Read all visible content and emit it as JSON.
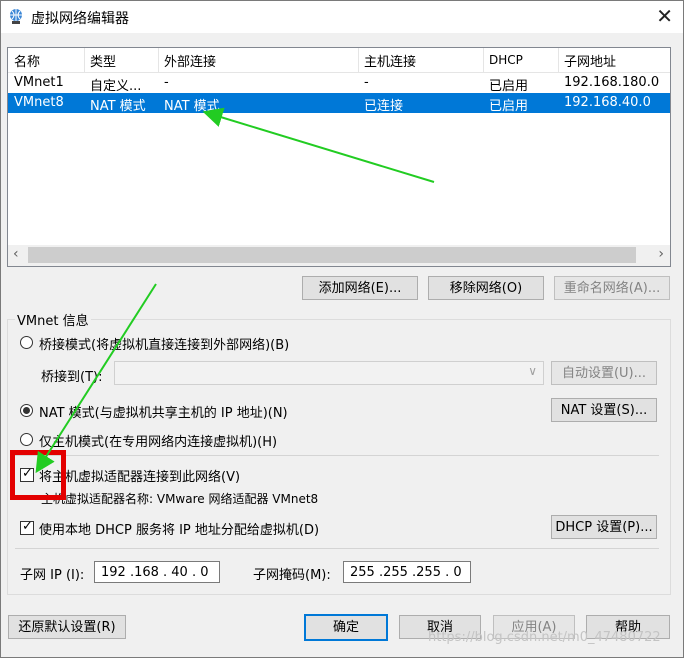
{
  "window": {
    "title": "虚拟网络编辑器",
    "close_glyph": "✕"
  },
  "table": {
    "columns": [
      "名称",
      "类型",
      "外部连接",
      "主机连接",
      "DHCP",
      "子网地址"
    ],
    "rows": [
      {
        "name": "VMnet1",
        "type": "自定义...",
        "external": "-",
        "host": "-",
        "dhcp": "已启用",
        "subnet": "192.168.180.0"
      },
      {
        "name": "VMnet8",
        "type": "NAT 模式",
        "external": "NAT 模式",
        "host": "已连接",
        "dhcp": "已启用",
        "subnet": "192.168.40.0",
        "selected": true
      }
    ]
  },
  "buttons": {
    "add_network": "添加网络(E)...",
    "remove_network": "移除网络(O)",
    "rename_network": "重命名网络(A)...",
    "auto_settings": "自动设置(U)...",
    "nat_settings": "NAT 设置(S)...",
    "dhcp_settings": "DHCP 设置(P)...",
    "restore_defaults": "还原默认设置(R)",
    "ok": "确定",
    "cancel": "取消",
    "apply": "应用(A)",
    "help": "帮助"
  },
  "vmnet_info": {
    "group_title": "VMnet 信息",
    "bridged_label": "桥接模式(将虚拟机直接连接到外部网络)(B)",
    "bridged_to_label": "桥接到(T):",
    "nat_label": "NAT 模式(与虚拟机共享主机的 IP 地址)(N)",
    "host_only_label": "仅主机模式(在专用网络内连接虚拟机)(H)",
    "connect_adapter_label": "将主机虚拟适配器连接到此网络(V)",
    "adapter_name_label": "主机虚拟适配器名称: VMware 网络适配器 VMnet8",
    "use_dhcp_label": "使用本地 DHCP 服务将 IP 地址分配给虚拟机(D)",
    "subnet_ip_label": "子网 IP (I):",
    "subnet_ip_value": "192 .168 . 40 .  0",
    "subnet_mask_label": "子网掩码(M):",
    "subnet_mask_value": "255 .255 .255 .  0",
    "selected_mode": "nat",
    "connect_adapter_checked": true,
    "use_dhcp_checked": true
  },
  "watermark": "https://blog.csdn.net/m0_47480722",
  "colors": {
    "selection": "#0078d7",
    "annotation_arrow": "#22cc22",
    "annotation_box": "#e30000"
  }
}
